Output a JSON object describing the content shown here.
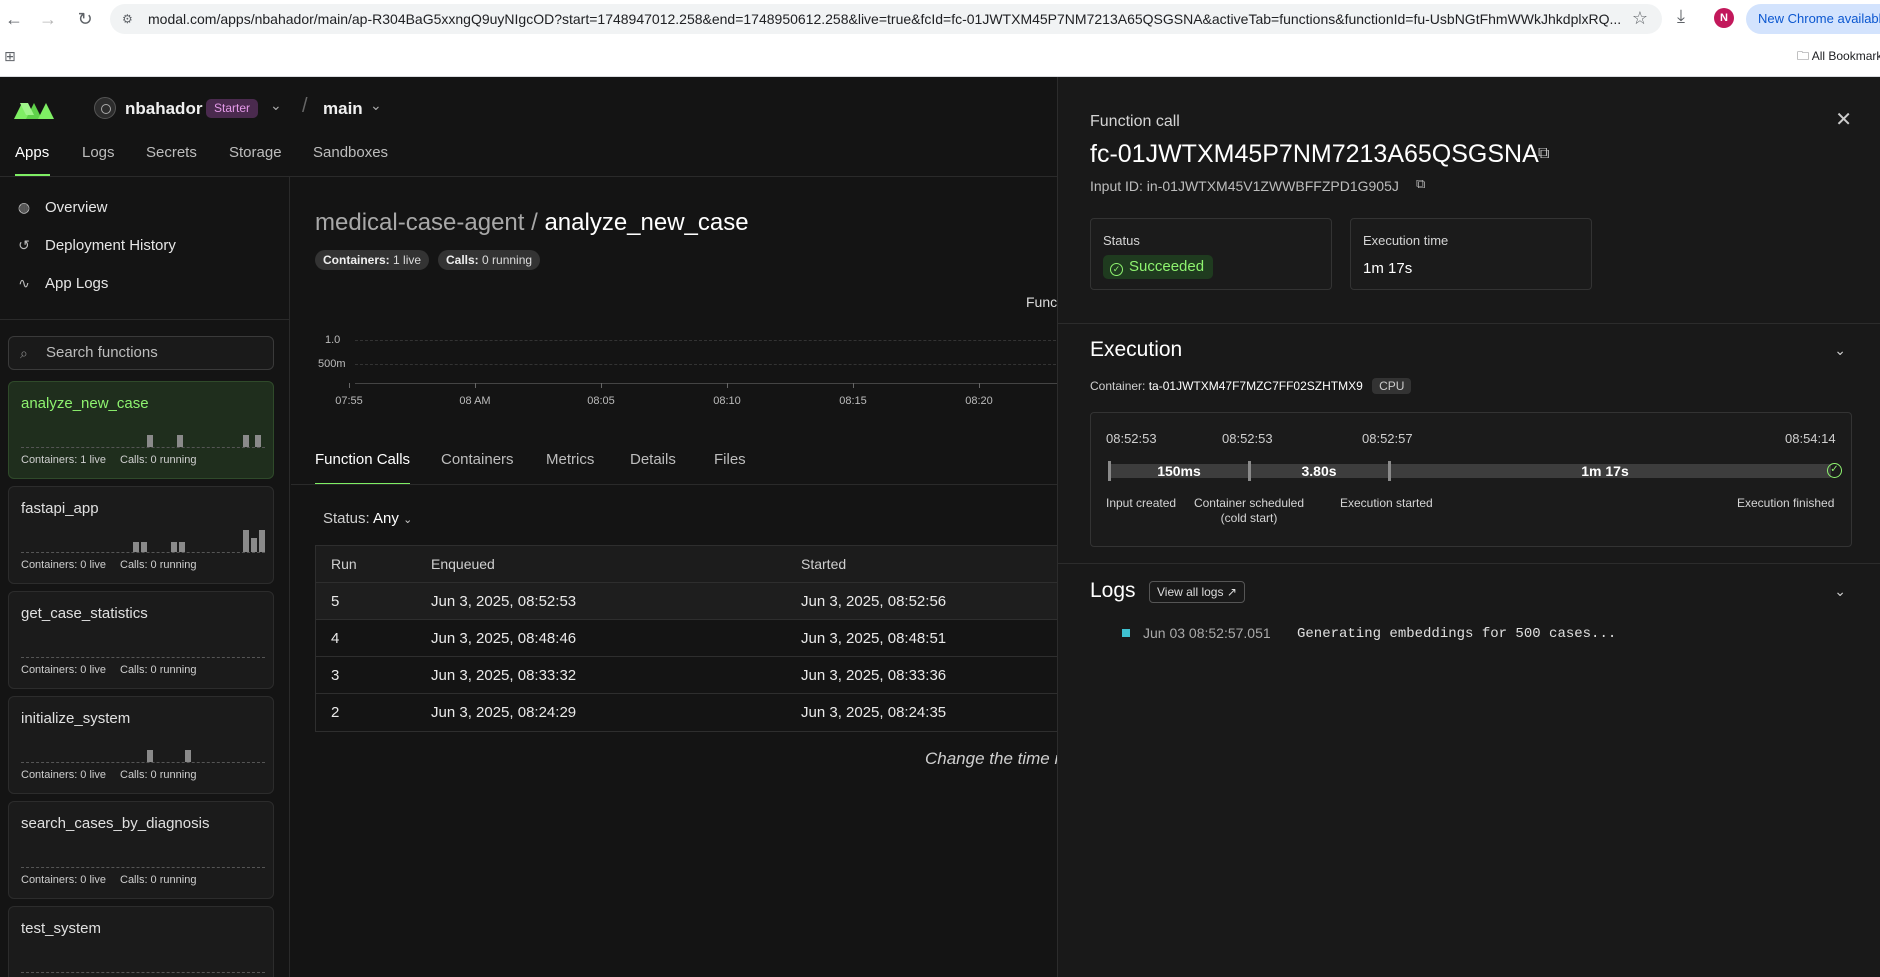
{
  "browser": {
    "url": "modal.com/apps/nbahador/main/ap-R304BaG5xxngQ9uyNIgcOD?start=1748947012.258&end=1748950612.258&live=true&fcId=fc-01JWTXM45P7NM7213A65QSGSNA&activeTab=functions&functionId=fu-UsbNGtFhmWWkJhkdplxRQ...",
    "profile_initial": "N",
    "update_label": "New Chrome available",
    "bookmarks_label": "All Bookmarks"
  },
  "header": {
    "workspace": "nbahador",
    "plan_badge": "Starter",
    "environment": "main",
    "nav": [
      "Apps",
      "Logs",
      "Secrets",
      "Storage",
      "Sandboxes"
    ]
  },
  "sidebar": {
    "links": [
      {
        "label": "Overview",
        "icon": "globe-icon"
      },
      {
        "label": "Deployment History",
        "icon": "history-icon"
      },
      {
        "label": "App Logs",
        "icon": "activity-icon"
      }
    ],
    "search_placeholder": "Search functions",
    "functions": [
      {
        "name": "analyze_new_case",
        "containers": "Containers: 1 live",
        "calls": "Calls: 0 running",
        "active": true
      },
      {
        "name": "fastapi_app",
        "containers": "Containers: 0 live",
        "calls": "Calls: 0 running"
      },
      {
        "name": "get_case_statistics",
        "containers": "Containers: 0 live",
        "calls": "Calls: 0 running"
      },
      {
        "name": "initialize_system",
        "containers": "Containers: 0 live",
        "calls": "Calls: 0 running"
      },
      {
        "name": "search_cases_by_diagnosis",
        "containers": "Containers: 0 live",
        "calls": "Calls: 0 running"
      },
      {
        "name": "test_system",
        "containers": "",
        "calls": ""
      }
    ]
  },
  "main": {
    "app_name": "medical-case-agent",
    "separator": "/",
    "function_name": "analyze_new_case",
    "containers_pill_label": "Containers:",
    "containers_pill_value": "1 live",
    "calls_pill_label": "Calls:",
    "calls_pill_value": "0 running",
    "chart_title": "Func",
    "chart": {
      "y_ticks": [
        "1.0",
        "500m"
      ],
      "x_ticks": [
        "07:55",
        "08 AM",
        "08:05",
        "08:10",
        "08:15",
        "08:20"
      ]
    },
    "tabs": [
      "Function Calls",
      "Containers",
      "Metrics",
      "Details",
      "Files"
    ],
    "status_filter_label": "Status:",
    "status_filter_value": "Any",
    "table": {
      "headers": [
        "Run",
        "Enqueued",
        "Started"
      ],
      "rows": [
        [
          "5",
          "Jun 3, 2025, 08:52:53",
          "Jun 3, 2025, 08:52:56"
        ],
        [
          "4",
          "Jun 3, 2025, 08:48:46",
          "Jun 3, 2025, 08:48:51"
        ],
        [
          "3",
          "Jun 3, 2025, 08:33:32",
          "Jun 3, 2025, 08:33:36"
        ],
        [
          "2",
          "Jun 3, 2025, 08:24:29",
          "Jun 3, 2025, 08:24:35"
        ]
      ]
    },
    "change_time_text": "Change the time r"
  },
  "panel": {
    "kicker": "Function call",
    "function_call_id": "fc-01JWTXM45P7NM7213A65QSGSNA",
    "input_id": "Input ID: in-01JWTXM45V1ZWWBFFZPD1G905J",
    "status_label": "Status",
    "status_value": "Succeeded",
    "exec_time_label": "Execution time",
    "exec_time_value": "1m 17s",
    "execution_title": "Execution",
    "container_label": "Container:",
    "container_id": "ta-01JWTXM47F7MZC7FF02SZHTMX9",
    "container_kind": "CPU",
    "timeline": {
      "timestamps": [
        "08:52:53",
        "08:52:53",
        "08:52:57",
        "08:54:14"
      ],
      "durations": [
        "150ms",
        "3.80s",
        "1m 17s"
      ],
      "events": [
        "Input created",
        "Container scheduled (cold start)",
        "Execution started",
        "Execution finished"
      ]
    },
    "logs_title": "Logs",
    "view_all_logs": "View all logs",
    "log_entries": [
      {
        "ts": "Jun 03  08:52:57.051",
        "msg": "Generating embeddings for 500 cases..."
      }
    ]
  },
  "colors": {
    "accent_green": "#7fee64",
    "succeeded_bg": "#1f3b1f",
    "plan_badge": "#e59ae9",
    "log_dot": "#3fc1d0"
  }
}
